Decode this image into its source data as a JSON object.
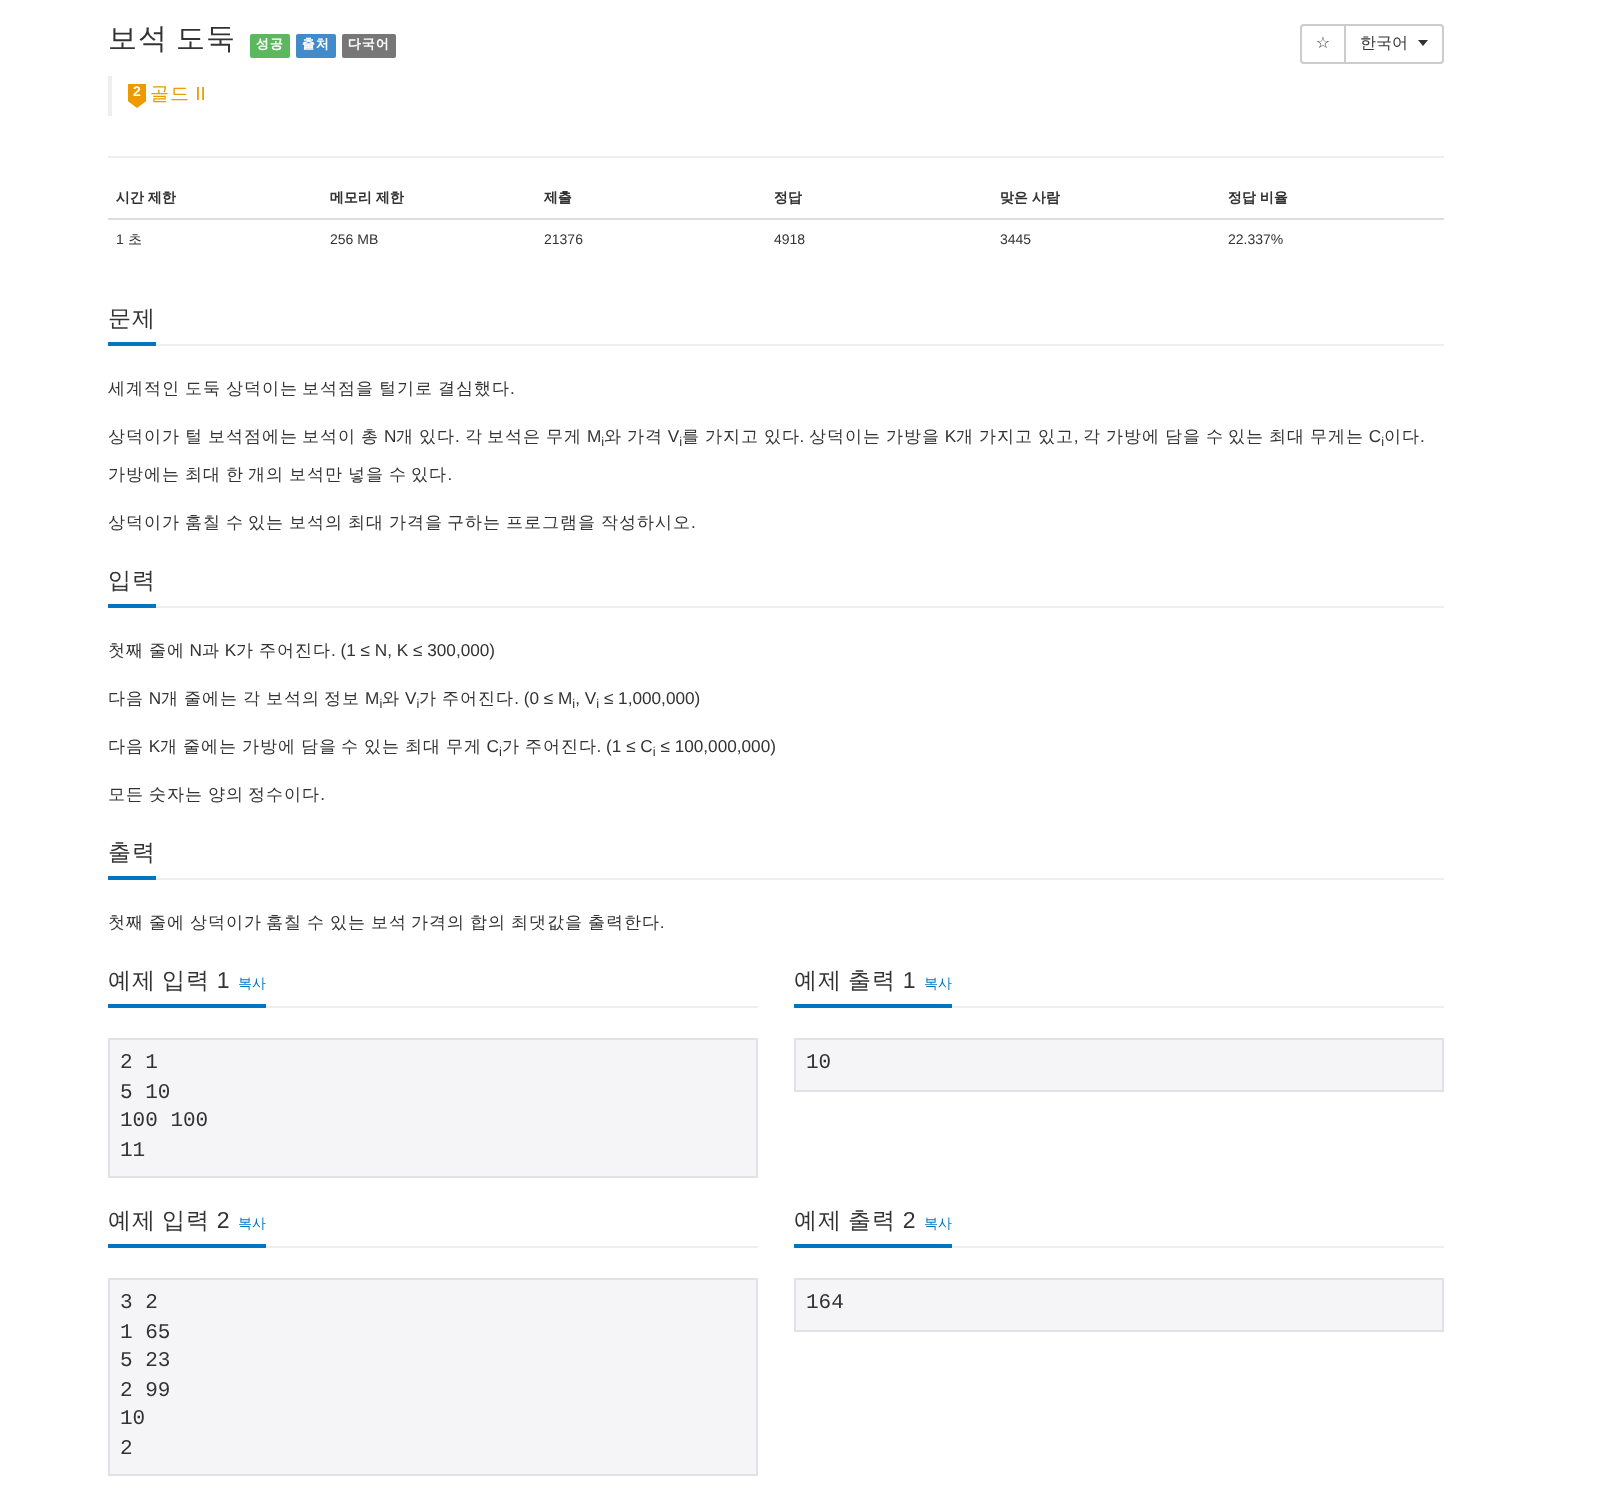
{
  "title": "보석 도둑",
  "labels": [
    {
      "text": "성공",
      "color": "#5cb85c"
    },
    {
      "text": "출처",
      "color": "#428bca"
    },
    {
      "text": "다국어",
      "color": "#777777"
    }
  ],
  "toolbar": {
    "star": "☆",
    "language": "한국어"
  },
  "tier": {
    "rank": "2",
    "label": "골드 II"
  },
  "stats_table": {
    "columns": [
      "시간 제한",
      "메모리 제한",
      "제출",
      "정답",
      "맞은 사람",
      "정답 비율"
    ],
    "rows": [
      [
        "1 초",
        "256 MB",
        "21376",
        "4918",
        "3445",
        "22.337%"
      ]
    ]
  },
  "sections": [
    {
      "title": "문제",
      "paragraphs": [
        "세계적인 도둑 상덕이는 보석점을 털기로 결심했다.",
        "상덕이가 털 보석점에는 보석이 총 N개 있다. 각 보석은 무게 M$_{i}$와 가격 V$_{i}$를 가지고 있다. 상덕이는 가방을 K개 가지고 있고, 각 가방에 담을 수 있는 최대 무게는 C$_{i}$이다. 가방에는 최대 한 개의 보석만 넣을 수 있다.",
        "상덕이가 훔칠 수 있는 보석의 최대 가격을 구하는 프로그램을 작성하시오."
      ]
    },
    {
      "title": "입력",
      "paragraphs": [
        "첫째 줄에 N과 K가 주어진다. (1 ≤ N, K ≤ 300,000)",
        "다음 N개 줄에는 각 보석의 정보 M$_{i}$와 V$_{i}$가 주어진다. (0 ≤ M$_{i}$, V$_{i}$ ≤ 1,000,000)",
        "다음 K개 줄에는 가방에 담을 수 있는 최대 무게 C$_{i}$가 주어진다. (1 ≤ C$_{i}$ ≤ 100,000,000)",
        "모든 숫자는 양의 정수이다."
      ]
    },
    {
      "title": "출력",
      "paragraphs": [
        "첫째 줄에 상덕이가 훔칠 수 있는 보석 가격의 합의 최댓값을 출력한다."
      ]
    }
  ],
  "examples": [
    {
      "title": "예제 입력 1",
      "copy": "복사",
      "data": "2 1\n5 10\n100 100\n11"
    },
    {
      "title": "예제 출력 1",
      "copy": "복사",
      "data": "10"
    },
    {
      "title": "예제 입력 2",
      "copy": "복사",
      "data": "3 2\n1 65\n5 23\n2 99\n10\n2"
    },
    {
      "title": "예제 출력 2",
      "copy": "복사",
      "data": "164"
    }
  ]
}
